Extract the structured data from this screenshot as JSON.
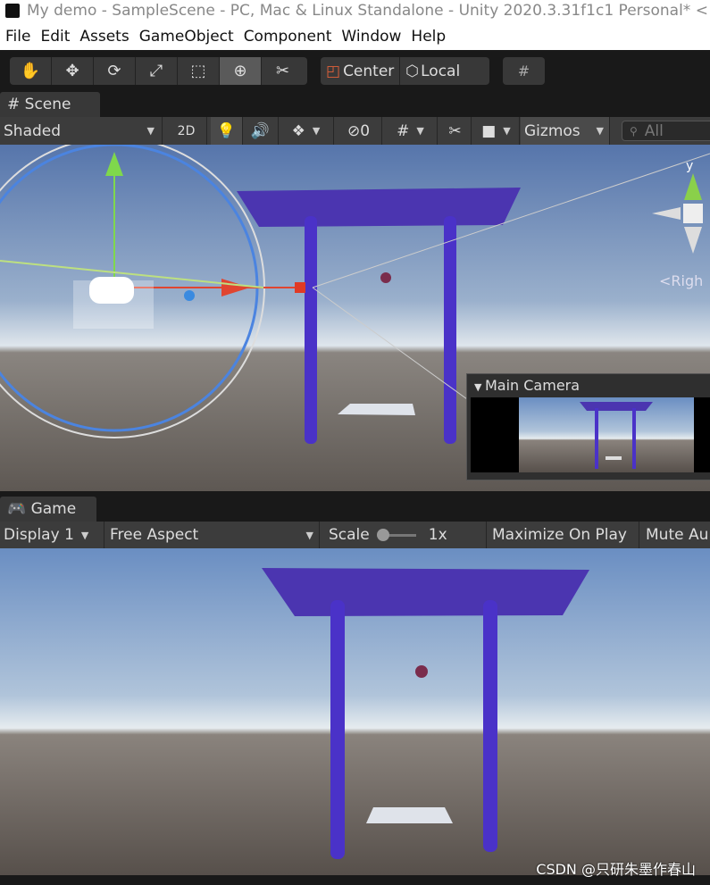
{
  "window": {
    "title": "My demo - SampleScene - PC, Mac & Linux Standalone - Unity 2020.3.31f1c1 Personal* <"
  },
  "menu": [
    "File",
    "Edit",
    "Assets",
    "GameObject",
    "Component",
    "Window",
    "Help"
  ],
  "toolbar": {
    "tools": [
      "hand",
      "move",
      "rotate",
      "scale",
      "rect",
      "transform",
      "custom"
    ],
    "active_tool": "transform",
    "pivot_label": "Center",
    "space_label": "Local"
  },
  "scene": {
    "tab_label": "Scene",
    "draw_mode": "Shaded",
    "mode_2d": "2D",
    "hidden_count": "0",
    "gizmos_label": "Gizmos",
    "search_placeholder": "All",
    "axis_label": "y",
    "persp_label": "<Righ",
    "camera_preview_title": "Main Camera"
  },
  "game": {
    "tab_label": "Game",
    "display": "Display 1",
    "aspect": "Free Aspect",
    "scale_label": "Scale",
    "scale_value": "1x",
    "maximize_label": "Maximize On Play",
    "mute_label": "Mute Au"
  },
  "watermark": "CSDN @只研朱墨作春山",
  "colors": {
    "accent_active": "#5a5a5a",
    "shape": "#5b3fc4",
    "sky": "#5a7bb0",
    "ground": "#6b6560"
  }
}
